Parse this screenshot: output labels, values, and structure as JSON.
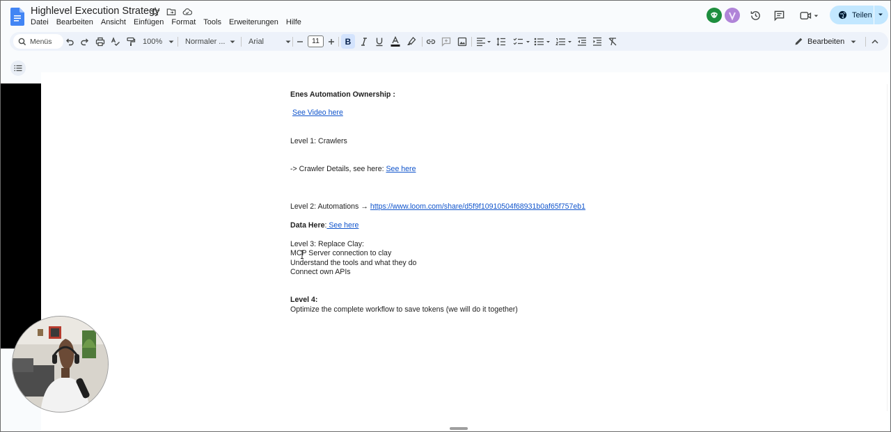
{
  "document": {
    "title": "Highlevel Execution Strategy"
  },
  "menu": {
    "items": [
      "Datei",
      "Bearbeiten",
      "Ansicht",
      "Einfügen",
      "Format",
      "Tools",
      "Erweiterungen",
      "Hilfe"
    ]
  },
  "header": {
    "share_label": "Teilen"
  },
  "toolbar": {
    "search_label": "Menüs",
    "zoom": "100%",
    "style": "Normaler ...",
    "font": "Arial",
    "font_size": "11",
    "bold_glyph": "B",
    "mode_label": "Bearbeiten"
  },
  "content": {
    "heading": "Enes Automation Ownership :",
    "video_link": "See Video here",
    "level1": "Level 1: Crawlers",
    "crawler_prefix": "-> Crawler Details, see here: ",
    "crawler_link": "See here",
    "level2_prefix": "Level 2: Automations → ",
    "level2_link": "https://www.loom.com/share/d5f9f10910504f68931b0af65f757eb1",
    "data_label": "Data Here",
    "data_colon": ":",
    "data_link": " See here",
    "level3_title": "Level 3: Replace Clay:",
    "level3_item1": "MCP Server connection to clay",
    "level3_item2": "Understand the tools and what they do",
    "level3_item3": "Connect own APIs",
    "level4_title": "Level 4:",
    "level4_text": " Optimize the complete workflow to save tokens (we will do it together)"
  },
  "colors": {
    "link": "#1155cc",
    "share_button": "#c2e7ff",
    "toolbar_bg": "#edf2fa",
    "bold_active": "#d3e3fd"
  }
}
